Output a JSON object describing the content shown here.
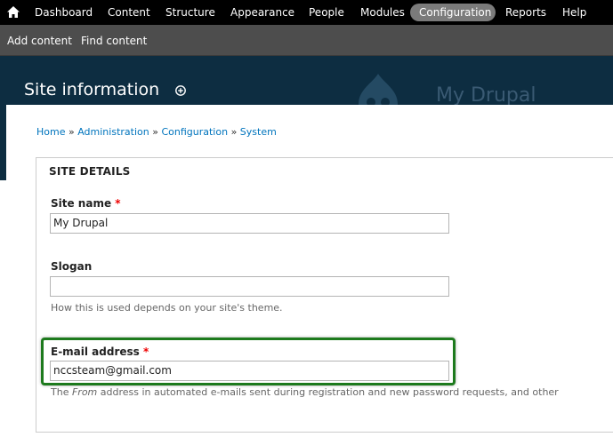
{
  "toolbar": {
    "items": [
      "Dashboard",
      "Content",
      "Structure",
      "Appearance",
      "People",
      "Modules",
      "Configuration",
      "Reports",
      "Help"
    ],
    "active": "Configuration"
  },
  "shortcuts": {
    "items": [
      "Add content",
      "Find content"
    ]
  },
  "header": {
    "title": "Site information",
    "site_name": "My Drupal"
  },
  "breadcrumb": [
    "Home",
    "Administration",
    "Configuration",
    "System"
  ],
  "breadcrumb_separator": "»",
  "fieldset": {
    "legend": "SITE DETAILS",
    "site_name": {
      "label": "Site name",
      "required_mark": "*",
      "value": "My Drupal"
    },
    "slogan": {
      "label": "Slogan",
      "value": "",
      "description": "How this is used depends on your site's theme."
    },
    "email": {
      "label": "E-mail address",
      "required_mark": "*",
      "value": "nccsteam@gmail.com",
      "description_prefix": "The",
      "description_em": "From",
      "description_suffix": "address in automated e-mails sent during registration and new password requests, and other"
    }
  },
  "colors": {
    "toolbar_bg": "#000000",
    "shortcut_bg": "#4d4d4d",
    "header_bg": "#0d2d41",
    "link": "#0074bd",
    "required": "#ee0000",
    "highlight": "#1d7a1d"
  }
}
